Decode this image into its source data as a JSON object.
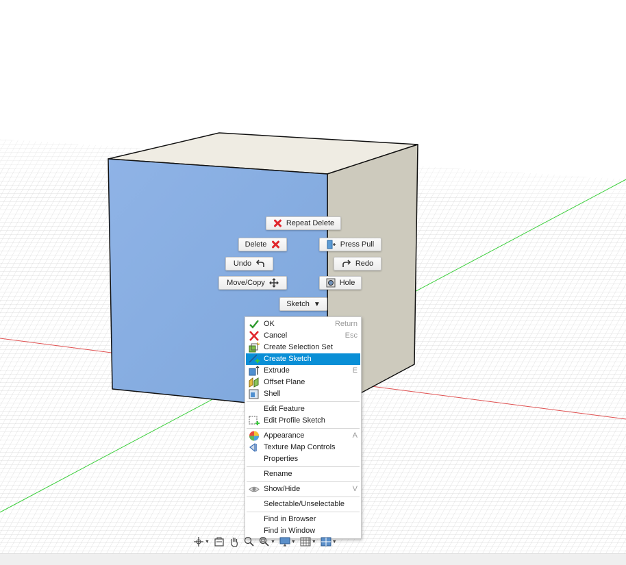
{
  "marking_menu": {
    "repeat_delete": "Repeat Delete",
    "delete": "Delete",
    "press_pull": "Press Pull",
    "undo": "Undo",
    "redo": "Redo",
    "move_copy": "Move/Copy",
    "hole": "Hole",
    "sketch": "Sketch"
  },
  "context_menu": {
    "items": [
      {
        "label": "OK",
        "shortcut": "Return",
        "icon": "check-icon"
      },
      {
        "label": "Cancel",
        "shortcut": "Esc",
        "icon": "cancel-icon"
      },
      {
        "label": "Create Selection Set",
        "shortcut": "",
        "icon": "selection-set-icon"
      },
      {
        "label": "Create Sketch",
        "shortcut": "",
        "icon": "create-sketch-icon",
        "highlighted": true
      },
      {
        "label": "Extrude",
        "shortcut": "E",
        "icon": "extrude-icon"
      },
      {
        "label": "Offset Plane",
        "shortcut": "",
        "icon": "offset-plane-icon"
      },
      {
        "label": "Shell",
        "shortcut": "",
        "icon": "shell-icon"
      },
      {
        "label": "Edit Feature",
        "shortcut": "",
        "icon": ""
      },
      {
        "label": "Edit Profile Sketch",
        "shortcut": "",
        "icon": "edit-profile-sketch-icon"
      },
      {
        "label": "Appearance",
        "shortcut": "A",
        "icon": "appearance-icon"
      },
      {
        "label": "Texture Map Controls",
        "shortcut": "",
        "icon": "texture-map-icon"
      },
      {
        "label": "Properties",
        "shortcut": "",
        "icon": ""
      },
      {
        "label": "Rename",
        "shortcut": "",
        "icon": ""
      },
      {
        "label": "Show/Hide",
        "shortcut": "V",
        "icon": "eye-icon"
      },
      {
        "label": "Selectable/Unselectable",
        "shortcut": "",
        "icon": ""
      },
      {
        "label": "Find in Browser",
        "shortcut": "",
        "icon": ""
      },
      {
        "label": "Find in Window",
        "shortcut": "",
        "icon": ""
      }
    ]
  },
  "navbar": {
    "icons": [
      "orbit-icon",
      "look-at-icon",
      "pan-hand-icon",
      "zoom-icon",
      "fit-zoom-icon",
      "display-settings-icon",
      "grid-settings-icon",
      "viewports-icon"
    ]
  },
  "colors": {
    "selected_face": "#82aadf",
    "highlight": "#0a8fd6",
    "x_axis": "#e05050",
    "y_axis": "#3ccf3c"
  }
}
